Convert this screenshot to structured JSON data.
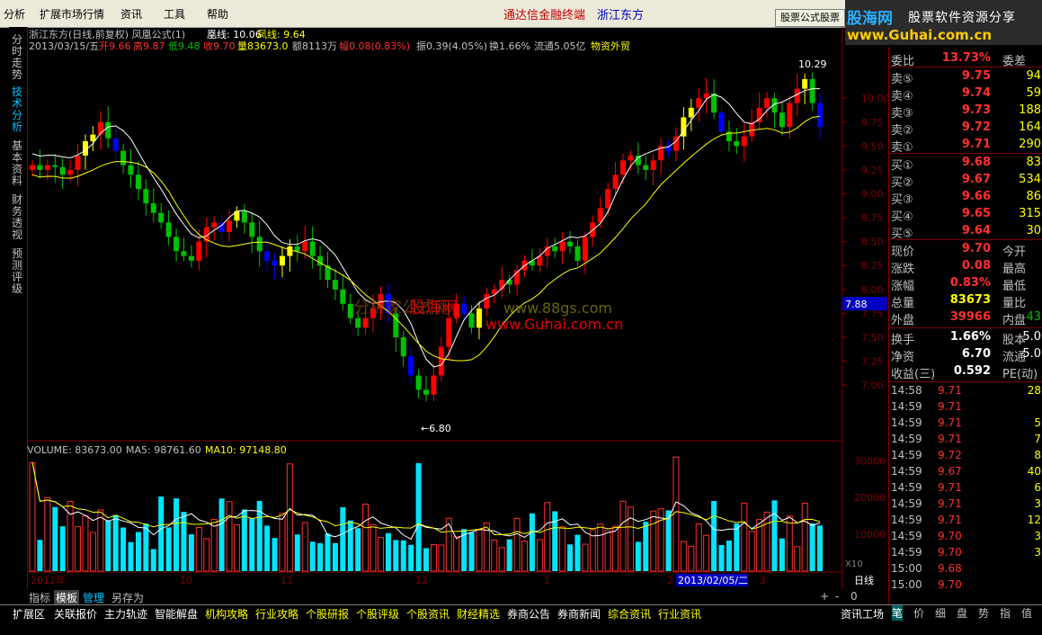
{
  "menu": [
    "分析",
    "扩展市场行情",
    "资讯",
    "工具",
    "帮助"
  ],
  "broker_title": "通达信金融终端",
  "stock_title": "浙江东方",
  "formula_button": "股票公式股票",
  "logo": {
    "cn": "股海网",
    "slogan": "股票软件资源分享",
    "url": "www.Guhai.com.cn"
  },
  "left_tabs": [
    "分时走势",
    "技术分析",
    "基本资料",
    "财务透视",
    "预测评级"
  ],
  "chart_header": {
    "title": "浙江东方(日线,前复权) 凤凰公式(1)",
    "line1_label": "凰线: 10.06",
    "line2_label": "凤线: 9.64",
    "date": "2013/03/15/五",
    "open": "开9.66",
    "high": "高9.87",
    "low": "低9.48",
    "close": "收9.70",
    "vol": "量83673.0",
    "amount": "额8113万",
    "range": "幅0.08(0.83%)",
    "swing": "振0.39(4.05%)",
    "turn": "换1.66%",
    "float": "流通5.05亿",
    "sector": "物资外贸"
  },
  "price_axis": [
    "10.00",
    "9.75",
    "9.50",
    "9.25",
    "9.00",
    "8.75",
    "8.50",
    "8.25",
    "8.00",
    "7.75",
    "7.50",
    "7.25",
    "7.00"
  ],
  "current_price_tag": "7.88",
  "high_annotation": "10.29",
  "low_annotation": "←6.80",
  "watermarks": [
    "分析家公式网",
    "股海网",
    "www.88gs.com",
    "www.Guhai.com.cn"
  ],
  "volume_header": {
    "vol": "VOLUME: 83673.00",
    "ma5": "MA5: 98761.60",
    "ma10": "MA10: 97148.80"
  },
  "volume_axis": [
    "30000",
    "20000",
    "10000"
  ],
  "volume_unit": "X10",
  "date_axis": [
    "2012年",
    "10",
    "11",
    "12",
    "1",
    "2",
    "3"
  ],
  "date_tag": "2013/02/05/二",
  "period_label": "日线",
  "zoom_controls": [
    "+",
    "-",
    "0"
  ],
  "bottom_tools": [
    "指标",
    "模板",
    "管理",
    "另存为"
  ],
  "status_items": [
    "扩展区",
    "关联报价",
    "主力轨迹",
    "智能解盘",
    "机构攻略",
    "行业攻略",
    "个股研报",
    "个股评级",
    "个股资讯",
    "财经精选",
    "券商公告",
    "券商新闻",
    "综合资讯",
    "行业资讯",
    "资讯工场"
  ],
  "rp_tabs": [
    "笔",
    "价",
    "细",
    "盘",
    "势",
    "指",
    "值"
  ],
  "order_book": {
    "weibi": {
      "label": "委比",
      "value": "13.73%",
      "label2": "委差"
    },
    "asks": [
      {
        "label": "卖⑤",
        "price": "9.75",
        "vol": "94"
      },
      {
        "label": "卖④",
        "price": "9.74",
        "vol": "59"
      },
      {
        "label": "卖③",
        "price": "9.73",
        "vol": "188"
      },
      {
        "label": "卖②",
        "price": "9.72",
        "vol": "164"
      },
      {
        "label": "卖①",
        "price": "9.71",
        "vol": "290"
      }
    ],
    "bids": [
      {
        "label": "买①",
        "price": "9.68",
        "vol": "83"
      },
      {
        "label": "买②",
        "price": "9.67",
        "vol": "534"
      },
      {
        "label": "买③",
        "price": "9.66",
        "vol": "86"
      },
      {
        "label": "买④",
        "price": "9.65",
        "vol": "315"
      },
      {
        "label": "买⑤",
        "price": "9.64",
        "vol": "30"
      }
    ]
  },
  "quote_stats": [
    {
      "label": "现价",
      "value": "9.70",
      "label2": "今开"
    },
    {
      "label": "涨跌",
      "value": "0.08",
      "label2": "最高"
    },
    {
      "label": "涨幅",
      "value": "0.83%",
      "label2": "最低"
    },
    {
      "label": "总量",
      "value": "83673",
      "label2": "量比"
    },
    {
      "label": "外盘",
      "value": "39966",
      "label2": "内盘",
      "value2": "43"
    }
  ],
  "fundamentals": [
    {
      "label": "换手",
      "value": "1.66%",
      "label2": "股本",
      "value2": "5.0"
    },
    {
      "label": "净资",
      "value": "6.70",
      "label2": "流通",
      "value2": "5.0"
    },
    {
      "label": "收益(三)",
      "value": "0.592",
      "label2": "PE(动)"
    }
  ],
  "ticks": [
    {
      "time": "14:58",
      "price": "9.71",
      "vol": "28"
    },
    {
      "time": "14:59",
      "price": "9.71",
      "vol": ""
    },
    {
      "time": "14:59",
      "price": "9.71",
      "vol": "5"
    },
    {
      "time": "14:59",
      "price": "9.71",
      "vol": "7"
    },
    {
      "time": "14:59",
      "price": "9.72",
      "vol": "8"
    },
    {
      "time": "14:59",
      "price": "9.67",
      "vol": "40"
    },
    {
      "time": "14:59",
      "price": "9.71",
      "vol": "6"
    },
    {
      "time": "14:59",
      "price": "9.71",
      "vol": "3"
    },
    {
      "time": "14:59",
      "price": "9.71",
      "vol": "12"
    },
    {
      "time": "14:59",
      "price": "9.70",
      "vol": "3"
    },
    {
      "time": "14:59",
      "price": "9.70",
      "vol": "3"
    },
    {
      "time": "15:00",
      "price": "9.68",
      "vol": ""
    },
    {
      "time": "15:00",
      "price": "9.70",
      "vol": ""
    }
  ],
  "chart_data": {
    "type": "candlestick",
    "ylim": [
      6.7,
      10.35
    ],
    "closes": [
      9.3,
      9.25,
      9.3,
      9.28,
      9.2,
      9.25,
      9.4,
      9.55,
      9.62,
      9.75,
      9.58,
      9.45,
      9.3,
      9.2,
      9.05,
      8.9,
      8.8,
      8.7,
      8.55,
      8.4,
      8.35,
      8.3,
      8.5,
      8.65,
      8.7,
      8.6,
      8.72,
      8.82,
      8.7,
      8.55,
      8.4,
      8.3,
      8.25,
      8.35,
      8.45,
      8.4,
      8.5,
      8.35,
      8.25,
      8.1,
      8.0,
      7.85,
      7.7,
      7.6,
      7.7,
      7.8,
      7.95,
      7.75,
      7.5,
      7.3,
      7.1,
      6.95,
      6.9,
      7.1,
      7.4,
      7.7,
      7.85,
      7.75,
      7.6,
      7.8,
      7.95,
      8.0,
      8.1,
      8.05,
      8.2,
      8.3,
      8.25,
      8.35,
      8.45,
      8.4,
      8.5,
      8.45,
      8.3,
      8.55,
      8.7,
      8.85,
      9.05,
      9.2,
      9.35,
      9.4,
      9.3,
      9.25,
      9.35,
      9.5,
      9.45,
      9.6,
      9.8,
      9.9,
      10.0,
      10.05,
      9.85,
      9.65,
      9.55,
      9.5,
      9.6,
      9.75,
      9.9,
      10.0,
      9.85,
      9.7,
      9.95,
      10.1,
      10.2,
      9.95,
      9.7
    ],
    "volume_max": 33000
  }
}
